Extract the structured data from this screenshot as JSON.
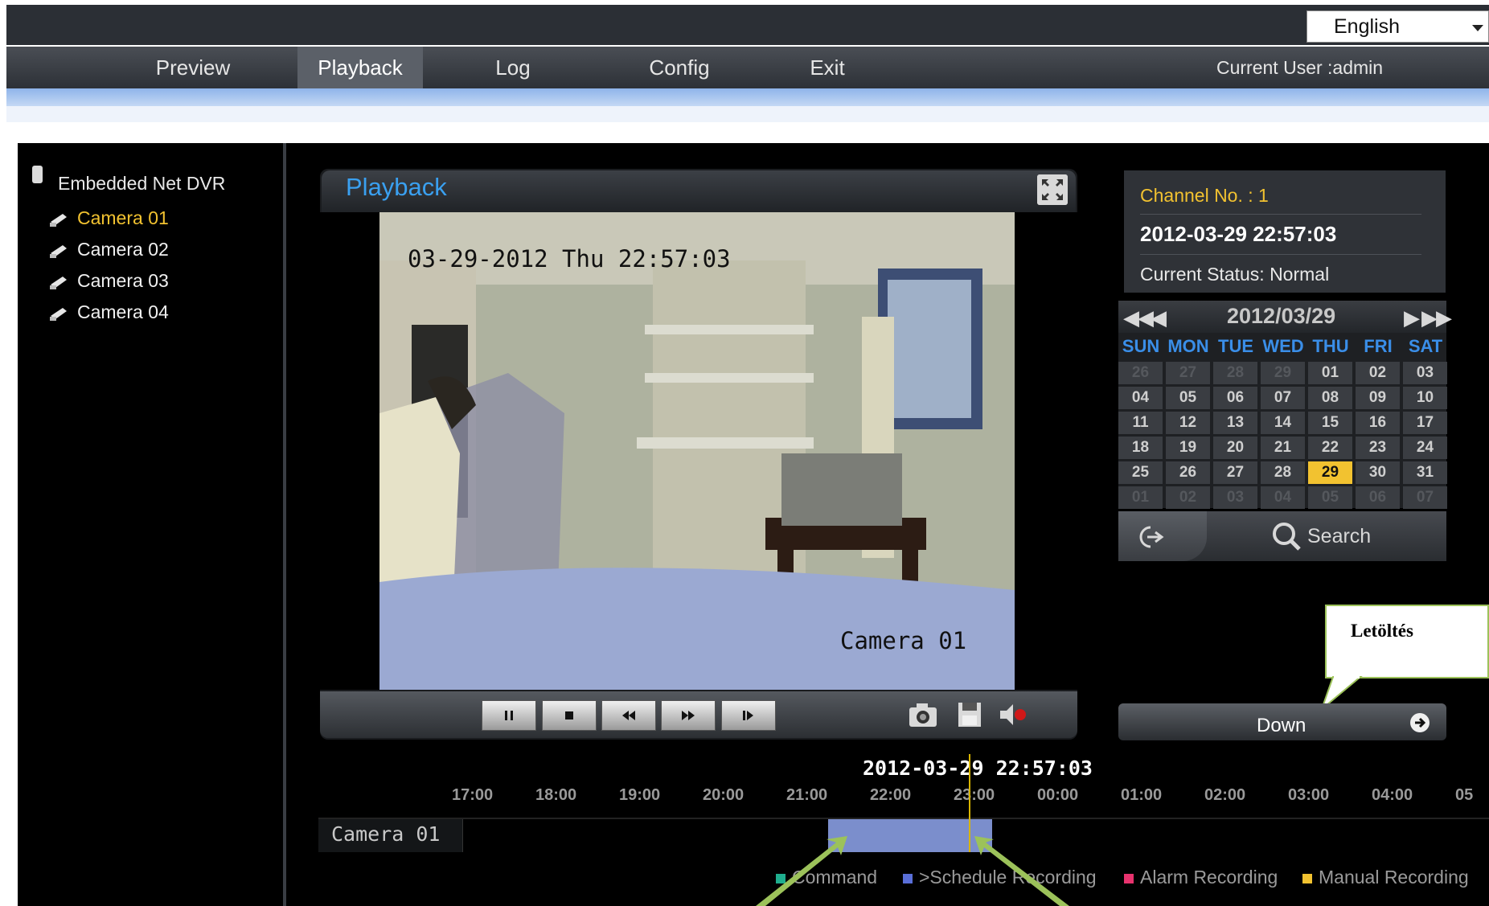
{
  "header": {
    "language": "English",
    "current_user": "Current User :admin",
    "nav": [
      {
        "label": "Preview",
        "active": false
      },
      {
        "label": "Playback",
        "active": true
      },
      {
        "label": "Log",
        "active": false
      },
      {
        "label": "Config",
        "active": false
      },
      {
        "label": "Exit",
        "active": false
      }
    ]
  },
  "device_tree": {
    "root": "Embedded Net DVR",
    "cameras": [
      {
        "label": "Camera 01",
        "selected": true
      },
      {
        "label": "Camera 02",
        "selected": false
      },
      {
        "label": "Camera 03",
        "selected": false
      },
      {
        "label": "Camera 04",
        "selected": false
      }
    ]
  },
  "player": {
    "title": "Playback",
    "osd_time": "03-29-2012 Thu 22:57:03",
    "osd_camera": "Camera 01",
    "controls": [
      "pause",
      "stop",
      "rewind",
      "fast-forward",
      "step-frame"
    ],
    "tools": [
      "snapshot",
      "save-clip",
      "audio"
    ]
  },
  "info": {
    "channel": "Channel No. :  1",
    "datetime": "2012-03-29 22:57:03",
    "status": "Current Status: Normal"
  },
  "calendar": {
    "title": "2012/03/29",
    "days_of_week": [
      "SUN",
      "MON",
      "TUE",
      "WED",
      "THU",
      "FRI",
      "SAT"
    ],
    "weeks": [
      [
        "26",
        "27",
        "28",
        "29",
        "01",
        "02",
        "03"
      ],
      [
        "04",
        "05",
        "06",
        "07",
        "08",
        "09",
        "10"
      ],
      [
        "11",
        "12",
        "13",
        "14",
        "15",
        "16",
        "17"
      ],
      [
        "18",
        "19",
        "20",
        "21",
        "22",
        "23",
        "24"
      ],
      [
        "25",
        "26",
        "27",
        "28",
        "29",
        "30",
        "31"
      ],
      [
        "01",
        "02",
        "03",
        "04",
        "05",
        "06",
        "07"
      ]
    ],
    "selected_day": "29",
    "search_label": "Search"
  },
  "download": {
    "callout": "Letöltés",
    "button_label": "Down"
  },
  "timeline": {
    "current": "2012-03-29 22:57:03",
    "ticks": [
      "17:00",
      "18:00",
      "19:00",
      "20:00",
      "21:00",
      "22:00",
      "23:00",
      "00:00",
      "01:00",
      "02:00",
      "03:00",
      "04:00",
      "05"
    ],
    "row_label": "Camera 01",
    "legend": [
      {
        "label": "Command",
        "color": "#1fae8e"
      },
      {
        "label": ">Schedule Recording",
        "color": "#5a6fd8"
      },
      {
        "label": "Alarm Recording",
        "color": "#e8336e"
      },
      {
        "label": "Manual Recording",
        "color": "#f2c230"
      }
    ]
  },
  "colors": {
    "accent_yellow": "#f2c230",
    "title_blue": "#3aa0f0",
    "record_blue": "#7b8ecc",
    "callout_green": "#9cc25a"
  }
}
